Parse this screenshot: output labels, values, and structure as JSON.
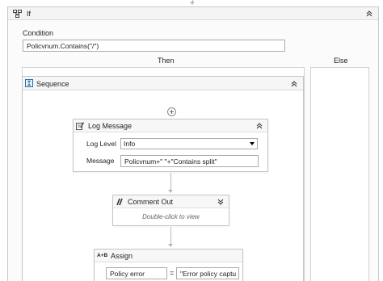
{
  "if_activity": {
    "title": "If",
    "condition_label": "Condition",
    "condition_value": "Policvnum.Contains(\"/\")",
    "then_label": "Then",
    "else_label": "Else"
  },
  "sequence": {
    "title": "Sequence"
  },
  "log_message": {
    "title": "Log Message",
    "level_label": "Log Level",
    "level_value": "Info",
    "message_label": "Message",
    "message_value": "Policvnum+\" \"+\"Contains split\""
  },
  "comment_out": {
    "title": "Comment Out",
    "hint": "Double-click to view"
  },
  "assign": {
    "title": "Assign",
    "icon_text": "A+B",
    "to_value": "Policy error",
    "equals": "=",
    "value_value": "\"Error policy captu"
  },
  "colors": {
    "border": "#c5c5c5",
    "accent_blue": "#2b6cb0",
    "connector": "#b8b8b8"
  }
}
